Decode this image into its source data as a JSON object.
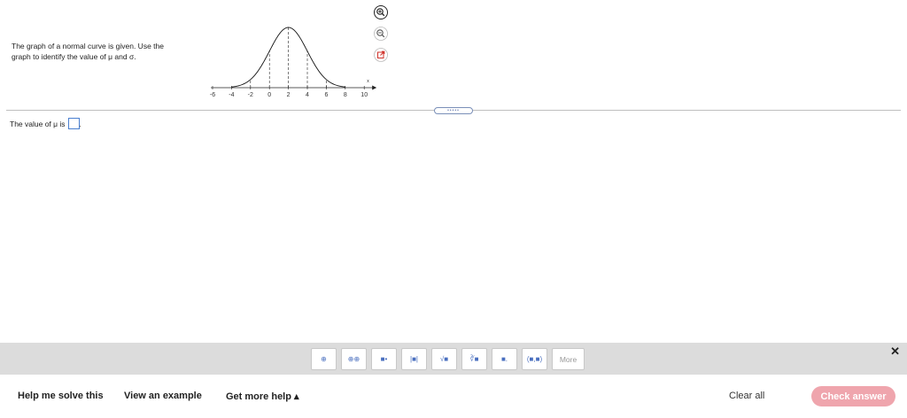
{
  "question": {
    "line1": "The graph of a normal curve is given. Use the",
    "line2": "graph to identify the value of μ and σ."
  },
  "graph": {
    "axis_label": "x",
    "ticks": [
      "-6",
      "-4",
      "-2",
      "0",
      "2",
      "4",
      "6",
      "8",
      "10"
    ],
    "mean": 2,
    "sigma": 2
  },
  "tools": {
    "zoom_in": "zoom-in-icon",
    "zoom_out": "zoom-out-icon",
    "popout": "popout-icon"
  },
  "answer": {
    "prefix": "The value of μ is",
    "suffix": "."
  },
  "palette": {
    "buttons": [
      "⊕",
      "⊕⊕",
      "■•",
      "|■|",
      "√■",
      "∛■",
      "■.",
      "(■,■)"
    ],
    "more": "More"
  },
  "footer": {
    "help": "Help me solve this",
    "example": "View an example",
    "more_help": "Get more help ▴",
    "clear": "Clear all",
    "check": "Check answer"
  },
  "colors": {
    "accent": "#4a7fd0",
    "check_button": "#efa5ad",
    "palette_bar": "#dcdcdc"
  }
}
